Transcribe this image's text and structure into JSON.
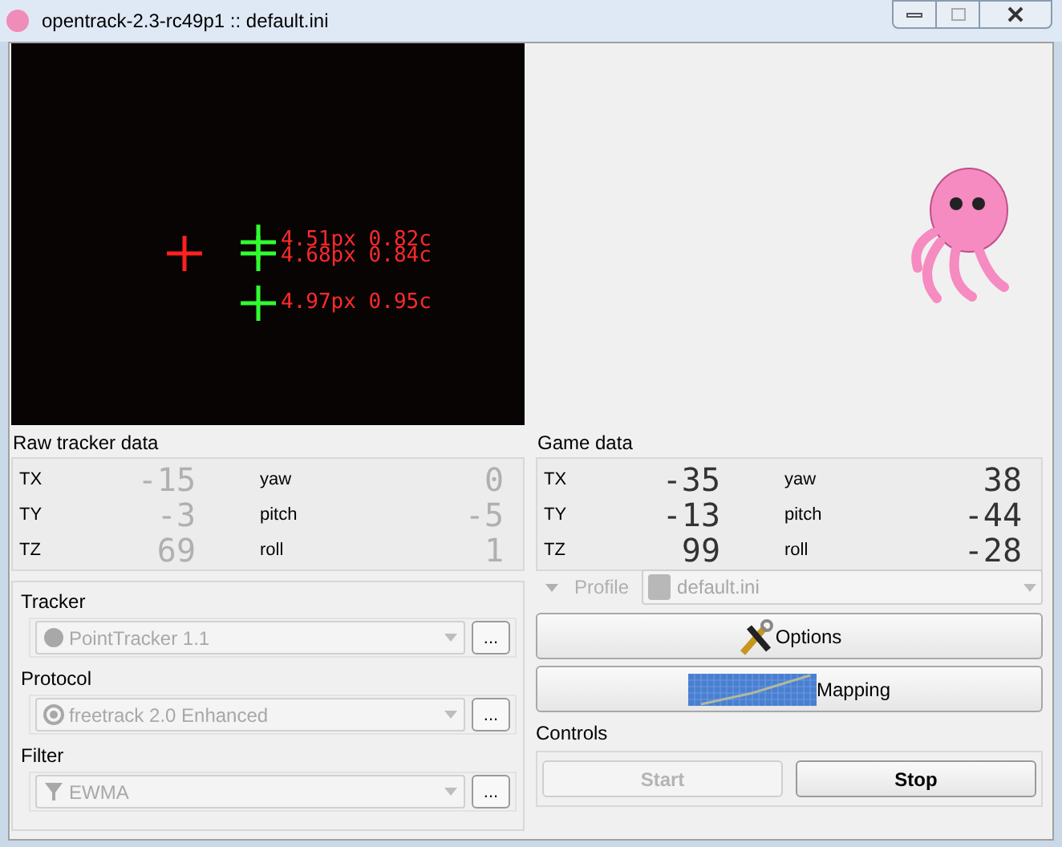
{
  "window": {
    "title": "opentrack-2.3-rc49p1 :: default.ini"
  },
  "camera": {
    "points": [
      {
        "kind": "centre"
      },
      {
        "kind": "point",
        "label": "4.51px 0.82c"
      },
      {
        "kind": "point",
        "label": "4.68px 0.84c"
      },
      {
        "kind": "point",
        "label": "4.97px 0.95c"
      }
    ]
  },
  "raw_tracker_data": {
    "title": "Raw tracker data",
    "disabled": true,
    "rows": [
      {
        "label": "TX",
        "value": "-15",
        "label_2": "yaw",
        "value_2": "0"
      },
      {
        "label": "TY",
        "value": "-3",
        "label_2": "pitch",
        "value_2": "-5"
      },
      {
        "label": "TZ",
        "value": "69",
        "label_2": "roll",
        "value_2": "1"
      }
    ]
  },
  "game_data": {
    "title": "Game data",
    "disabled": false,
    "rows": [
      {
        "label": "TX",
        "value": "-35",
        "label_2": "yaw",
        "value_2": "38"
      },
      {
        "label": "TY",
        "value": "-13",
        "label_2": "pitch",
        "value_2": "-44"
      },
      {
        "label": "TZ",
        "value": "99",
        "label_2": "roll",
        "value_2": "-28"
      }
    ]
  },
  "modules": [
    {
      "kind": "tracker",
      "label": "Tracker",
      "value": "PointTracker 1.1",
      "disabled": true,
      "button": "..."
    },
    {
      "kind": "protocol",
      "label": "Protocol",
      "value": "freetrack 2.0 Enhanced",
      "disabled": true,
      "button": "..."
    },
    {
      "kind": "filter",
      "label": "Filter",
      "value": "EWMA",
      "disabled": true,
      "button": "..."
    }
  ],
  "profile": {
    "label": "Profile",
    "value": "default.ini",
    "disabled": true
  },
  "buttons": [
    {
      "kind": "options",
      "label": "Options"
    },
    {
      "kind": "mapping",
      "label": "Mapping"
    }
  ],
  "controls": {
    "title": "Controls",
    "buttons": [
      {
        "label": "Start",
        "disabled": true
      },
      {
        "label": "Stop",
        "disabled": false
      }
    ]
  }
}
